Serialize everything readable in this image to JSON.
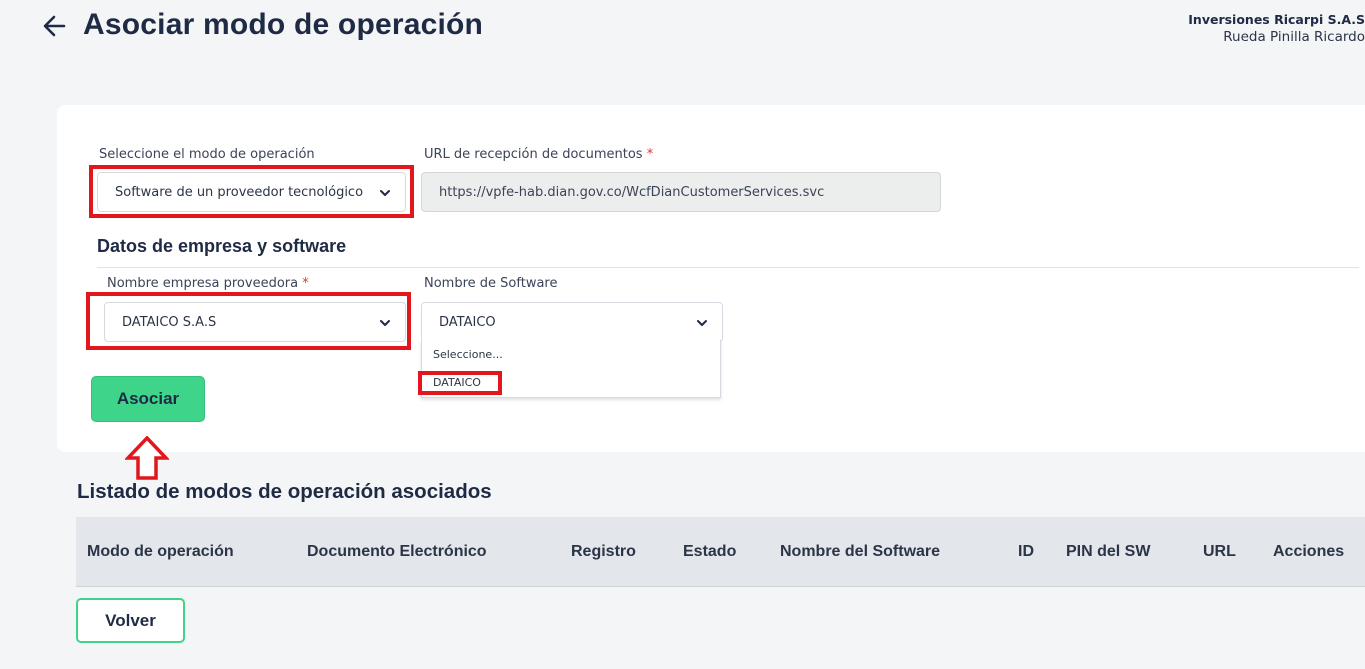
{
  "header": {
    "title": "Asociar modo de operación",
    "company": "Inversiones Ricarpi S.A.S",
    "user": "Rueda Pinilla Ricardo"
  },
  "form": {
    "mode_label": "Seleccione el modo de operación",
    "mode_value": "Software de un proveedor tecnológico",
    "url_label": "URL de recepción de documentos",
    "url_value": "https://vpfe-hab.dian.gov.co/WcfDianCustomerServices.svc",
    "required_mark": "*"
  },
  "section": {
    "title": "Datos de empresa y software",
    "company_label": "Nombre empresa proveedora",
    "company_value": "DATAICO S.A.S",
    "software_label": "Nombre de Software",
    "software_value": "DATAICO",
    "software_options": [
      "Seleccione...",
      "DATAICO"
    ]
  },
  "actions": {
    "associate": "Asociar",
    "back": "Volver"
  },
  "list": {
    "title": "Listado de modos de operación asociados",
    "columns": [
      "Modo de operación",
      "Documento Electrónico",
      "Registro",
      "Estado",
      "Nombre del Software",
      "ID",
      "PIN del SW",
      "URL",
      "Acciones"
    ]
  },
  "colors": {
    "accent": "#3ed48a",
    "highlight": "#e1171e",
    "title_text": "#1f2a44"
  }
}
